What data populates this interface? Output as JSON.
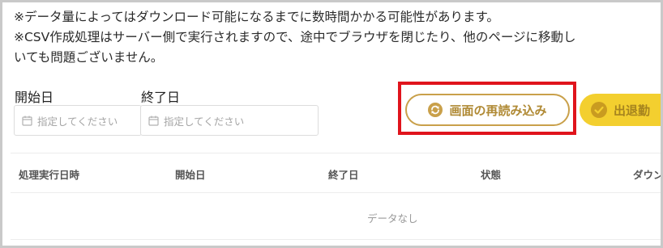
{
  "notes": {
    "line1": "※データ量によってはダウンロード可能になるまでに数時間かかる可能性があります。",
    "line2": "※CSV作成処理はサーバー側で実行されますので、途中でブラウザを閉じたり、他のページに移動し",
    "line3": "いても問題ございません。"
  },
  "filters": {
    "start_label": "開始日",
    "end_label": "終了日",
    "start_placeholder": "指定してください",
    "end_placeholder": "指定してください"
  },
  "actions": {
    "reload_label": "画面の再読み込み",
    "export_label": "出退勤"
  },
  "table": {
    "headers": [
      "処理実行日時",
      "開始日",
      "終了日",
      "状態",
      "ダウン"
    ],
    "empty_text": "データなし"
  },
  "colors": {
    "highlight": "#e0141c",
    "reload_accent": "#c9a04a",
    "export_bg": "#f3cf2f"
  },
  "icons": {
    "calendar": "calendar-icon",
    "reload": "reload-icon",
    "check": "check-circle-icon"
  }
}
